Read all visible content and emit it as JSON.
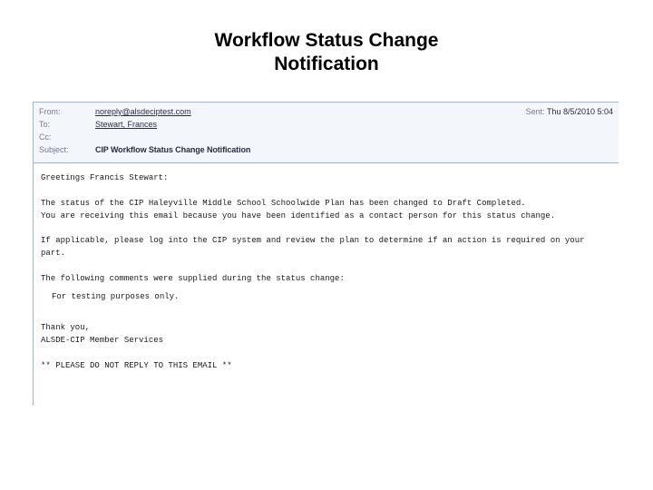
{
  "slide": {
    "title": "Workflow Status Change\nNotification"
  },
  "email": {
    "header": {
      "labels": {
        "from": "From:",
        "to": "To:",
        "cc": "Cc:",
        "subject": "Subject:",
        "sent": "Sent:"
      },
      "from": "noreply@alsdeciptest.com",
      "sent": "Thu 8/5/2010 5:04",
      "to": "Stewart, Frances",
      "cc": "",
      "subject": "CIP Workflow Status Change Notification"
    },
    "body": {
      "greeting": "Greetings Francis Stewart:",
      "status_line": "The status of the CIP Haleyville Middle School Schoolwide Plan has been changed to Draft Completed.",
      "reason_line": "You are receiving this email because you have been identified as a contact person for this status change.",
      "action_line": "If applicable, please log into the CIP system and review the plan to determine if an action is required on your part.",
      "comments_intro": "The following comments were supplied during the status change:",
      "comments": "For testing purposes only.",
      "thank_you": "Thank you,",
      "signature": "ALSDE-CIP Member Services",
      "no_reply": "** PLEASE DO NOT REPLY TO THIS EMAIL **"
    }
  }
}
